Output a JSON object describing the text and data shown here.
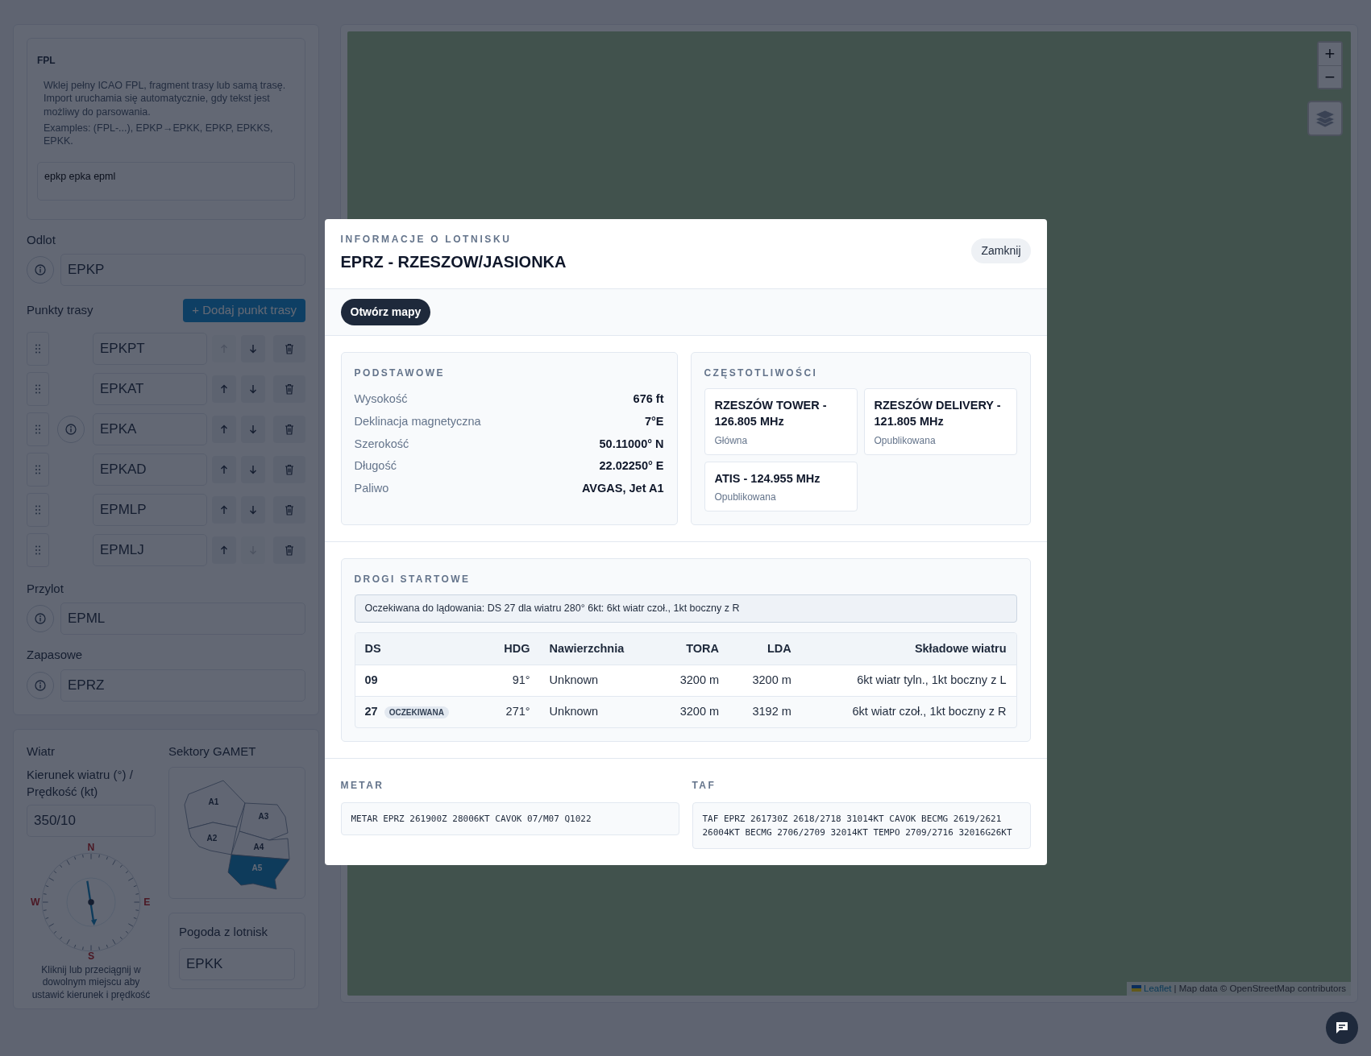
{
  "sidebar": {
    "fpl": {
      "title": "FPL",
      "help": [
        "Wklej pełny ICAO FPL, fragment trasy lub samą trasę. Import uruchamia się automatycznie, gdy tekst jest możliwy do parsowania.",
        "Examples: (FPL-...), EPKP→EPKK, EPKP, EPKKS, EPKK."
      ],
      "value": "epkp epka epml"
    },
    "departure": {
      "label": "Odlot",
      "value": "EPKP"
    },
    "waypoints": {
      "label": "Punkty trasy",
      "add_button": "+ Dodaj punkt trasy",
      "items": [
        {
          "value": "EPKPT",
          "info": false,
          "up_disabled": true,
          "down_disabled": false
        },
        {
          "value": "EPKAT",
          "info": false,
          "up_disabled": false,
          "down_disabled": false
        },
        {
          "value": "EPKA",
          "info": true,
          "up_disabled": false,
          "down_disabled": false
        },
        {
          "value": "EPKAD",
          "info": false,
          "up_disabled": false,
          "down_disabled": false
        },
        {
          "value": "EPMLP",
          "info": false,
          "up_disabled": false,
          "down_disabled": false
        },
        {
          "value": "EPMLJ",
          "info": false,
          "up_disabled": false,
          "down_disabled": true
        }
      ]
    },
    "arrival": {
      "label": "Przylot",
      "value": "EPML"
    },
    "alternate": {
      "label": "Zapasowe",
      "value": "EPRZ"
    },
    "wind": {
      "title": "Wiatr",
      "label": "Kierunek wiatru (°) / Prędkość (kt)",
      "value": "350/10",
      "compass_labels": [
        "N",
        "E",
        "S",
        "W"
      ],
      "hint": "Kliknij lub przeciągnij w dowolnym miejscu aby ustawić kierunek i prędkość"
    },
    "gamet": {
      "title": "Sektory GAMET",
      "sectors": [
        {
          "label": "A1",
          "selected": false
        },
        {
          "label": "A2",
          "selected": false
        },
        {
          "label": "A3",
          "selected": false
        },
        {
          "label": "A4",
          "selected": false
        },
        {
          "label": "A5",
          "selected": true
        }
      ]
    },
    "weather": {
      "title": "Pogoda z lotnisk",
      "value": "EPKK"
    }
  },
  "map": {
    "zoom_in": "+",
    "zoom_out": "−",
    "attribution": {
      "link": "Leaflet",
      "text": "| Map data © OpenStreetMap contributors"
    }
  },
  "modal": {
    "eyebrow": "INFORMACJE O LOTNISKU",
    "title": "EPRZ - RZESZOW/JASIONKA",
    "close": "Zamknij",
    "open_maps": "Otwórz mapy",
    "basic": {
      "title": "PODSTAWOWE",
      "rows": [
        {
          "label": "Wysokość",
          "value": "676 ft"
        },
        {
          "label": "Deklinacja magnetyczna",
          "value": "7°E"
        },
        {
          "label": "Szerokość",
          "value": "50.11000° N"
        },
        {
          "label": "Długość",
          "value": "22.02250° E"
        },
        {
          "label": "Paliwo",
          "value": "AVGAS, Jet A1"
        }
      ]
    },
    "frequencies": {
      "title": "CZĘSTOTLIWOŚCI",
      "items": [
        {
          "name": "RZESZÓW TOWER - 126.805 MHz",
          "status": "Główna"
        },
        {
          "name": "RZESZÓW DELIVERY - 121.805 MHz",
          "status": "Opublikowana"
        },
        {
          "name": "ATIS - 124.955 MHz",
          "status": "Opublikowana"
        }
      ]
    },
    "runways": {
      "title": "DROGI STARTOWE",
      "note": "Oczekiwana do lądowania: DS 27 dla wiatru 280° 6kt: 6kt wiatr czoł., 1kt boczny z R",
      "columns": [
        "DS",
        "HDG",
        "Nawierzchnia",
        "TORA",
        "LDA",
        "Składowe wiatru"
      ],
      "rows": [
        {
          "ds": "09",
          "hdg": "91°",
          "surface": "Unknown",
          "tora": "3200 m",
          "lda": "3200 m",
          "wind": "6kt wiatr tyln., 1kt boczny z L"
        },
        {
          "ds": "27",
          "badge": "OCZEKIWANA",
          "hdg": "271°",
          "surface": "Unknown",
          "tora": "3200 m",
          "lda": "3192 m",
          "wind": "6kt wiatr czoł., 1kt boczny z R"
        }
      ]
    },
    "metar": {
      "title": "METAR",
      "text": "METAR EPRZ 261900Z 28006KT CAVOK 07/M07 Q1022"
    },
    "taf": {
      "title": "TAF",
      "text": "TAF EPRZ 261730Z 2618/2718 31014KT CAVOK BECMG 2619/2621 26004KT BECMG 2706/2709 32014KT TEMPO 2709/2716 32016G26KT"
    }
  }
}
